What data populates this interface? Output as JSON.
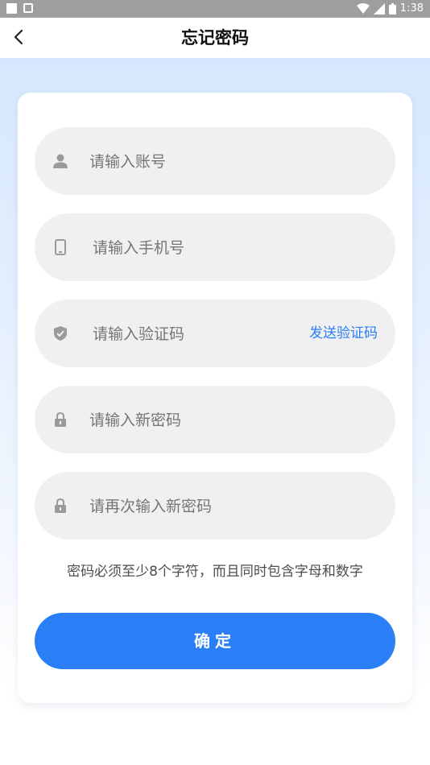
{
  "status_bar": {
    "time": "1:38"
  },
  "app_bar": {
    "title": "忘记密码"
  },
  "form": {
    "account_placeholder": "请输入账号",
    "phone_placeholder": "请输入手机号",
    "code_placeholder": "请输入验证码",
    "send_code_label": "发送验证码",
    "new_password_placeholder": "请输入新密码",
    "confirm_password_placeholder": "请再次输入新密码",
    "hint": "密码必须至少8个字符，而且同时包含字母和数字",
    "confirm_label": "确定"
  },
  "colors": {
    "accent": "#2a7ff7",
    "field_bg": "#f0f0f2",
    "icon": "#9a9a9a"
  },
  "icons": [
    "person-icon",
    "phone-icon",
    "shield-icon",
    "lock-icon",
    "back-arrow-icon"
  ]
}
